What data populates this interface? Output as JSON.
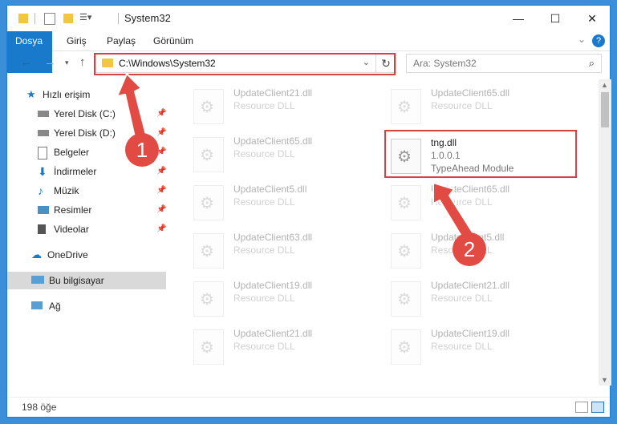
{
  "window": {
    "title": "System32"
  },
  "ribbon": {
    "tabs": [
      {
        "label": "Dosya"
      },
      {
        "label": "Giriş"
      },
      {
        "label": "Paylaş"
      },
      {
        "label": "Görünüm"
      }
    ],
    "help": "?"
  },
  "address": {
    "path": "C:\\Windows\\System32"
  },
  "search": {
    "placeholder": "Ara: System32"
  },
  "nav": {
    "quick_access": "Hızlı erişim",
    "items": [
      {
        "label": "Yerel Disk (C:)"
      },
      {
        "label": "Yerel Disk (D:)"
      },
      {
        "label": "Belgeler"
      },
      {
        "label": "İndirmeler"
      },
      {
        "label": "Müzik"
      },
      {
        "label": "Resimler"
      },
      {
        "label": "Videolar"
      }
    ],
    "onedrive": "OneDrive",
    "this_pc": "Bu bilgisayar",
    "network": "Ağ"
  },
  "files": {
    "left": [
      {
        "name": "UpdateClient21.dll",
        "desc": "Resource DLL"
      },
      {
        "name": "UpdateClient65.dll",
        "desc": "Resource DLL"
      },
      {
        "name": "UpdateClient5.dll",
        "desc": "Resource DLL"
      },
      {
        "name": "UpdateClient63.dll",
        "desc": "Resource DLL"
      },
      {
        "name": "UpdateClient19.dll",
        "desc": "Resource DLL"
      },
      {
        "name": "UpdateClient21.dll",
        "desc": "Resource DLL"
      }
    ],
    "right": [
      {
        "name": "UpdateClient65.dll",
        "desc": "Resource DLL"
      },
      {
        "name": "UpdateClient65.dll",
        "desc": "Resource DLL"
      },
      {
        "name": "UpdateClient5.dll",
        "desc": "Resource DLL"
      },
      {
        "name": "UpdateClient21.dll",
        "desc": "Resource DLL"
      },
      {
        "name": "UpdateClient19.dll",
        "desc": "Resource DLL"
      }
    ],
    "highlighted": {
      "name": "tng.dll",
      "version": "1.0.0.1",
      "desc": "TypeAhead Module"
    }
  },
  "status": {
    "count": "198 öğe"
  },
  "annotations": {
    "step1": "1",
    "step2": "2",
    "color": "#e24b43"
  }
}
